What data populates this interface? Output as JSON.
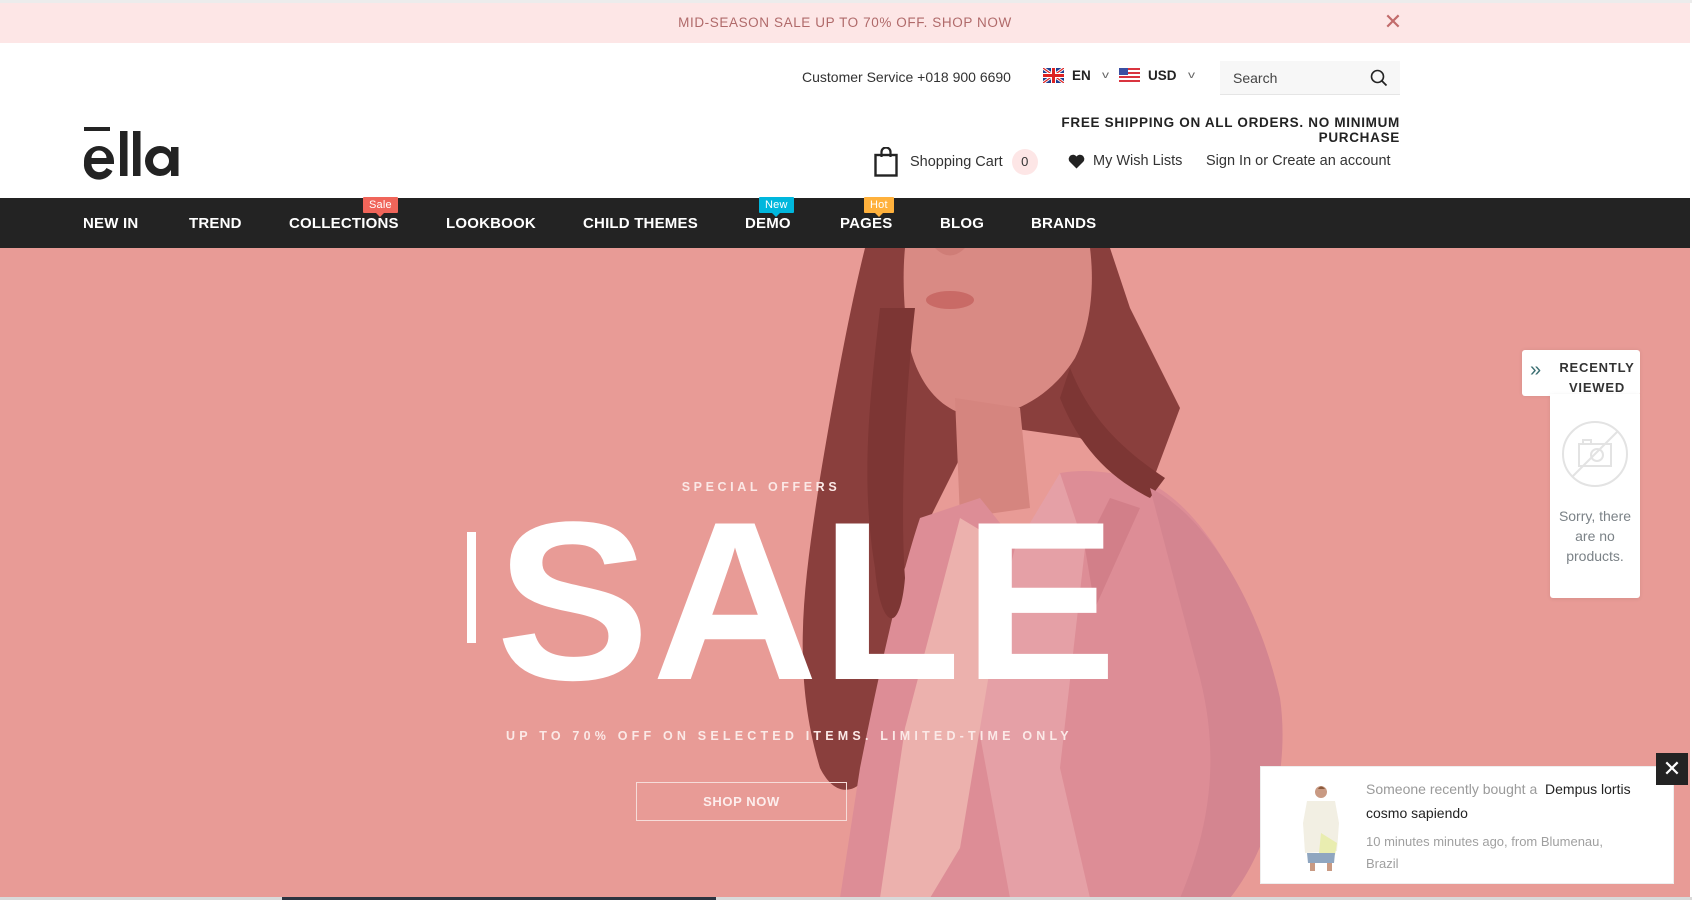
{
  "announcement": {
    "text": "MID-SEASON SALE UP TO 70% OFF. SHOP NOW",
    "close_icon": "close-icon"
  },
  "header": {
    "customer_service": "Customer Service +018 900 6690",
    "language": {
      "flag": "uk-flag-icon",
      "selected": "EN"
    },
    "currency": {
      "flag": "us-flag-icon",
      "selected": "USD"
    },
    "search": {
      "placeholder": "Search",
      "value": "",
      "icon": "search-icon"
    },
    "shipping_note": "FREE SHIPPING ON ALL ORDERS. NO MINIMUM PURCHASE",
    "cart": {
      "label": "Shopping Cart",
      "count": "0",
      "icon": "shopping-bag-icon"
    },
    "wishlist": {
      "label": "My Wish Lists",
      "icon": "heart-icon"
    },
    "account": {
      "label": "Sign In or Create an account"
    },
    "logo": "ella"
  },
  "nav": {
    "items": [
      {
        "label": "NEW IN"
      },
      {
        "label": "TREND"
      },
      {
        "label": "COLLECTIONS",
        "badge": "Sale"
      },
      {
        "label": "LOOKBOOK"
      },
      {
        "label": "CHILD THEMES"
      },
      {
        "label": "DEMO",
        "badge": "New"
      },
      {
        "label": "PAGES",
        "badge": "Hot"
      },
      {
        "label": "BLOG"
      },
      {
        "label": "BRANDS"
      }
    ],
    "badge_colors": {
      "Sale": "#f0655a",
      "New": "#00b7dd",
      "Hot": "#ffb13c"
    }
  },
  "hero": {
    "kicker": "SPECIAL OFFERS",
    "headline": "SALE",
    "subheadline": "UP TO 70% OFF ON SELECTED ITEMS. LIMITED-TIME ONLY",
    "cta": "SHOP NOW",
    "background": "#e89b96"
  },
  "recently_viewed": {
    "title": "RECENTLY VIEWED",
    "empty_message": "Sorry, there are no products.",
    "toggle_icon": "double-chevron-right-icon",
    "placeholder_icon": "no-image-icon"
  },
  "purchase_toast": {
    "prefix": "Someone recently bought a",
    "product": "Dempus lortis cosmo sapiendo",
    "meta": "10 minutes minutes ago, from Blumenau, Brazil",
    "close_icon": "close-icon"
  },
  "colors": {
    "announcement_bg": "#fde6e6",
    "nav_bg": "#232323",
    "accent_teal": "#3b6f72"
  }
}
